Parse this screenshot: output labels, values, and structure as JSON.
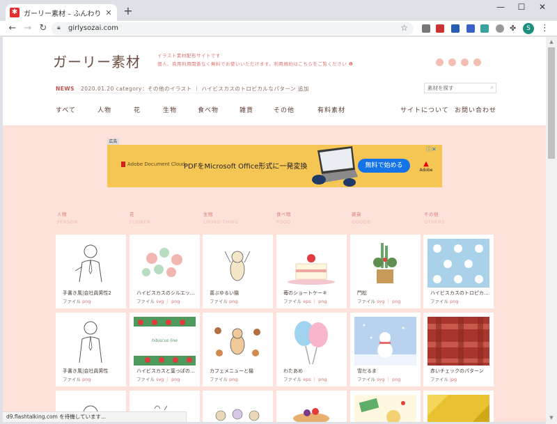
{
  "browser": {
    "tab_title": "ガーリー素材 – ふんわり可愛い無料イ",
    "tab_favicon": "✱",
    "url": "girlysozai.com",
    "profile_initial": "S",
    "status_text": "d9.flashtalking.com を待機しています..."
  },
  "site": {
    "logo": "ガーリー素材",
    "tagline_1": "イラスト素材配布サイトです",
    "tagline_2": "個人、商用利用関係なく無料でお使いいただけます。利用規約はこちらをご覧ください ❶",
    "news_label": "NEWS",
    "news_text": "2020.01.20  category：その他のイラスト ｜ ハイビスカスのトロピカルなパターン 追加",
    "search_placeholder": "素材を探す",
    "nav": [
      "すべて",
      "人物",
      "花",
      "生物",
      "食べ物",
      "雑貨",
      "その他",
      "有料素材"
    ],
    "nav_right": [
      "サイトについて",
      "お問い合わせ"
    ]
  },
  "ad": {
    "tag": "広告",
    "brand": "Adobe Document Cloud",
    "headline": "PDFをMicrosoft Office形式に一発変換",
    "cta": "無料で始める",
    "logo_text": "Adobe"
  },
  "categories": [
    {
      "jp": "人物",
      "en": "PERSON"
    },
    {
      "jp": "花",
      "en": "FLOWER"
    },
    {
      "jp": "生物",
      "en": "LIVING THING"
    },
    {
      "jp": "食べ物",
      "en": "FOOD"
    },
    {
      "jp": "雑貨",
      "en": "GOODS"
    },
    {
      "jp": "その他",
      "en": "OTHERS"
    }
  ],
  "cards": [
    {
      "title": "手書き風|会社員男性2",
      "file_label": "ファイル",
      "exts": "png"
    },
    {
      "title": "ハイビスカスのシルエッ…",
      "file_label": "ファイル",
      "exts": "svg ｜ png"
    },
    {
      "title": "喜ぶゆるい猫",
      "file_label": "ファイル",
      "exts": "png"
    },
    {
      "title": "苺のショートケーキ",
      "file_label": "ファイル",
      "exts": "eps ｜ png"
    },
    {
      "title": "門松",
      "file_label": "ファイル",
      "exts": "svg ｜ png"
    },
    {
      "title": "ハイビスカスのトロピカ…",
      "file_label": "ファイル",
      "exts": "png"
    },
    {
      "title": "手書き風|会社員男性",
      "file_label": "ファイル",
      "exts": "png"
    },
    {
      "title": "ハイビスカスと葉っぱの…",
      "file_label": "ファイル",
      "exts": "svg ｜ png"
    },
    {
      "title": "カフェメニューと猫",
      "file_label": "ファイル",
      "exts": "png"
    },
    {
      "title": "わたあめ",
      "file_label": "ファイル",
      "exts": "eps ｜ png"
    },
    {
      "title": "雪だるま",
      "file_label": "ファイル",
      "exts": "svg ｜ png"
    },
    {
      "title": "赤いチェックのパターン",
      "file_label": "ファイル",
      "exts": "jpg"
    }
  ],
  "hibiscus_text": "hibiscus line",
  "colors": {
    "accent": "#e07070",
    "pink_bg": "#fce2da",
    "logo": "#6b4b3e",
    "ad_bg": "#f6c655"
  }
}
